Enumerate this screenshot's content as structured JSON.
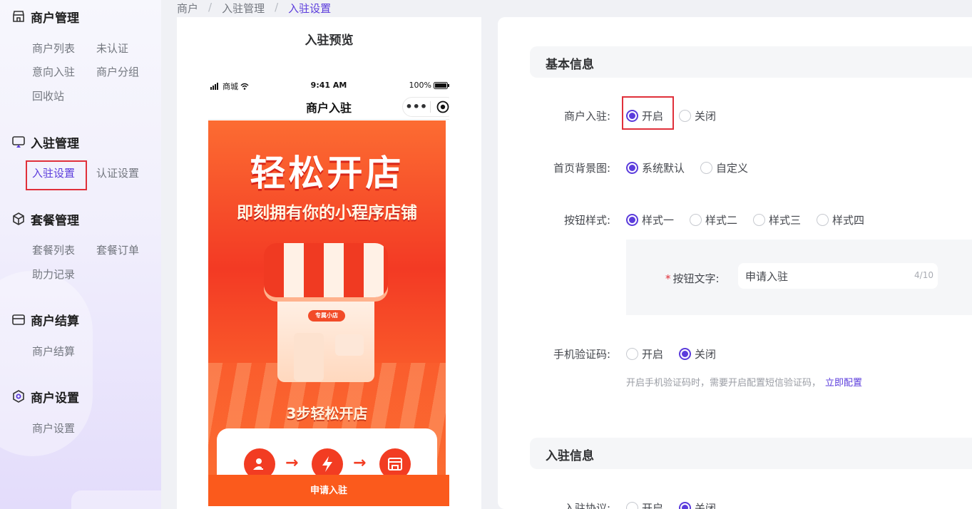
{
  "sidebar": {
    "groups": [
      {
        "title": "商户管理",
        "items": [
          "商户列表",
          "未认证",
          "意向入驻",
          "商户分组",
          "回收站"
        ]
      },
      {
        "title": "入驻管理",
        "items": [
          "入驻设置",
          "认证设置"
        ],
        "active": "入驻设置"
      },
      {
        "title": "套餐管理",
        "items": [
          "套餐列表",
          "套餐订单",
          "助力记录"
        ]
      },
      {
        "title": "商户结算",
        "items": [
          "商户结算"
        ]
      },
      {
        "title": "商户设置",
        "items": [
          "商户设置"
        ]
      }
    ]
  },
  "breadcrumb": [
    "商户",
    "入驻管理",
    "入驻设置"
  ],
  "preview": {
    "title": "入驻预览",
    "status": {
      "carrier": "商城",
      "time": "9:41 AM",
      "battery": "100%"
    },
    "nav_title": "商户入驻",
    "banner_title": "轻松开店",
    "banner_subtitle": "即刻拥有你的小程序店铺",
    "shop_sign": "专属小店",
    "steps_title": "3步轻松开店",
    "apply_button": "申请入驻"
  },
  "form": {
    "section_basic": "基本信息",
    "merchant_join": {
      "label": "商户入驻:",
      "options": [
        "开启",
        "关闭"
      ],
      "selected": "开启"
    },
    "home_bg": {
      "label": "首页背景图:",
      "options": [
        "系统默认",
        "自定义"
      ],
      "selected": "系统默认"
    },
    "button_style": {
      "label": "按钮样式:",
      "options": [
        "样式一",
        "样式二",
        "样式三",
        "样式四"
      ],
      "selected": "样式一"
    },
    "button_text": {
      "label": "按钮文字:",
      "value": "申请入驻",
      "counter": "4/10"
    },
    "sms_code": {
      "label": "手机验证码:",
      "options": [
        "开启",
        "关闭"
      ],
      "selected": "关闭"
    },
    "sms_hint": "开启手机验证码时，需要开启配置短信验证码，",
    "sms_hint_link": "立即配置",
    "section_join": "入驻信息",
    "agreement": {
      "label": "入驻协议:",
      "options": [
        "开启",
        "关闭"
      ],
      "selected": "关闭"
    }
  },
  "colors": {
    "accent": "#5b3cdc",
    "highlight_box": "#e0303a",
    "banner": "#f33a24"
  }
}
